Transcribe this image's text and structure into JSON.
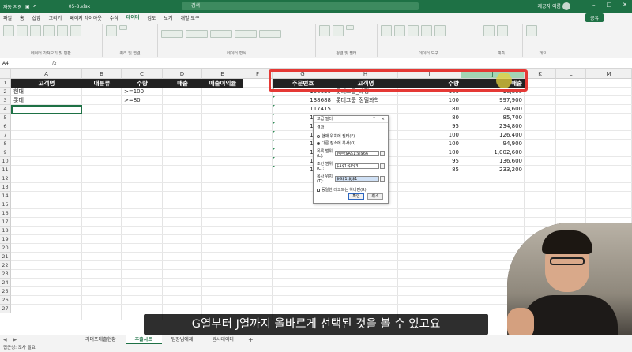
{
  "titlebar": {
    "autosave": "자동 저장",
    "filename": "05-8.xlsx",
    "search_placeholder": "검색",
    "user": "제공자 이름"
  },
  "ribbon_tabs": [
    "파일",
    "홈",
    "삽입",
    "그리기",
    "페이지 레이아웃",
    "수식",
    "데이터",
    "검토",
    "보기",
    "개발 도구"
  ],
  "share_label": "공유",
  "ribbon_groups": [
    {
      "label": "데이터 가져오기 및 변환"
    },
    {
      "label": "쿼리 및 연결"
    },
    {
      "label": "데이터 형식"
    },
    {
      "label": "정렬 및 필터"
    },
    {
      "label": "데이터 도구"
    },
    {
      "label": "예측"
    },
    {
      "label": "개요"
    }
  ],
  "name_box": "A4",
  "fx": "fx",
  "columns": [
    "A",
    "B",
    "C",
    "D",
    "E",
    "F",
    "G",
    "H",
    "I",
    "J",
    "K",
    "L",
    "M"
  ],
  "rows": [
    "1",
    "2",
    "3",
    "4",
    "5",
    "6",
    "7",
    "8",
    "9",
    "10",
    "11",
    "12",
    "13",
    "14",
    "15",
    "16",
    "17",
    "18",
    "19",
    "20",
    "21",
    "22",
    "23",
    "24",
    "25",
    "26",
    "27"
  ],
  "criteria": {
    "headers": [
      "고객명",
      "대분류",
      "수량",
      "매출",
      "매출이익율"
    ],
    "r2": {
      "a": "현대",
      "c": ">=100"
    },
    "r3": {
      "a": "롯데",
      "c": ">=80"
    }
  },
  "result": {
    "headers": [
      "주문번호",
      "고객명",
      "수량",
      "매출"
    ],
    "rows": [
      {
        "id": "150630",
        "name": "롯데그룹_대명",
        "qty": "100",
        "sales": "16,800"
      },
      {
        "id": "138688",
        "name": "롯데그룹_정밀화학",
        "qty": "100",
        "sales": "997,900"
      },
      {
        "id": "117415",
        "name": "",
        "qty": "80",
        "sales": "24,600"
      },
      {
        "id": "115812",
        "name": "",
        "qty": "80",
        "sales": "85,700"
      },
      {
        "id": "152156",
        "name": "",
        "qty": "95",
        "sales": "234,800"
      },
      {
        "id": "108966",
        "name": "",
        "qty": "100",
        "sales": "126,400"
      },
      {
        "id": "143338",
        "name": "",
        "qty": "100",
        "sales": "94,900"
      },
      {
        "id": "115742",
        "name": "",
        "qty": "100",
        "sales": "1,002,600"
      },
      {
        "id": "117415",
        "name": "",
        "qty": "95",
        "sales": "136,600"
      },
      {
        "id": "115742",
        "name": "",
        "qty": "85",
        "sales": "233,200"
      }
    ]
  },
  "dialog": {
    "title": "고급 필터",
    "help": "?",
    "close": "×",
    "section": "결과",
    "opt1": "현재 위치에 필터(F)",
    "opt2": "다른 장소에 복사(O)",
    "list_label": "목록 범위(L):",
    "list_value": "원본!$A$1:$J$66",
    "crit_label": "조건 범위(C):",
    "crit_value": "$A$1:$E$3",
    "copy_label": "복사 위치(T):",
    "copy_value": "$G$1:$J$1",
    "unique": "동일한 레코드는 하나만(R)",
    "ok": "확인",
    "cancel": "취소"
  },
  "sheets": [
    "리더프매출현황",
    "추출시트",
    "팀장님예제",
    "원시데이터"
  ],
  "active_sheet": "추출시트",
  "status": "접근성: 조사 필요",
  "caption": "G열부터 J열까지 올바르게 선택된 것을 볼 수 있고요"
}
